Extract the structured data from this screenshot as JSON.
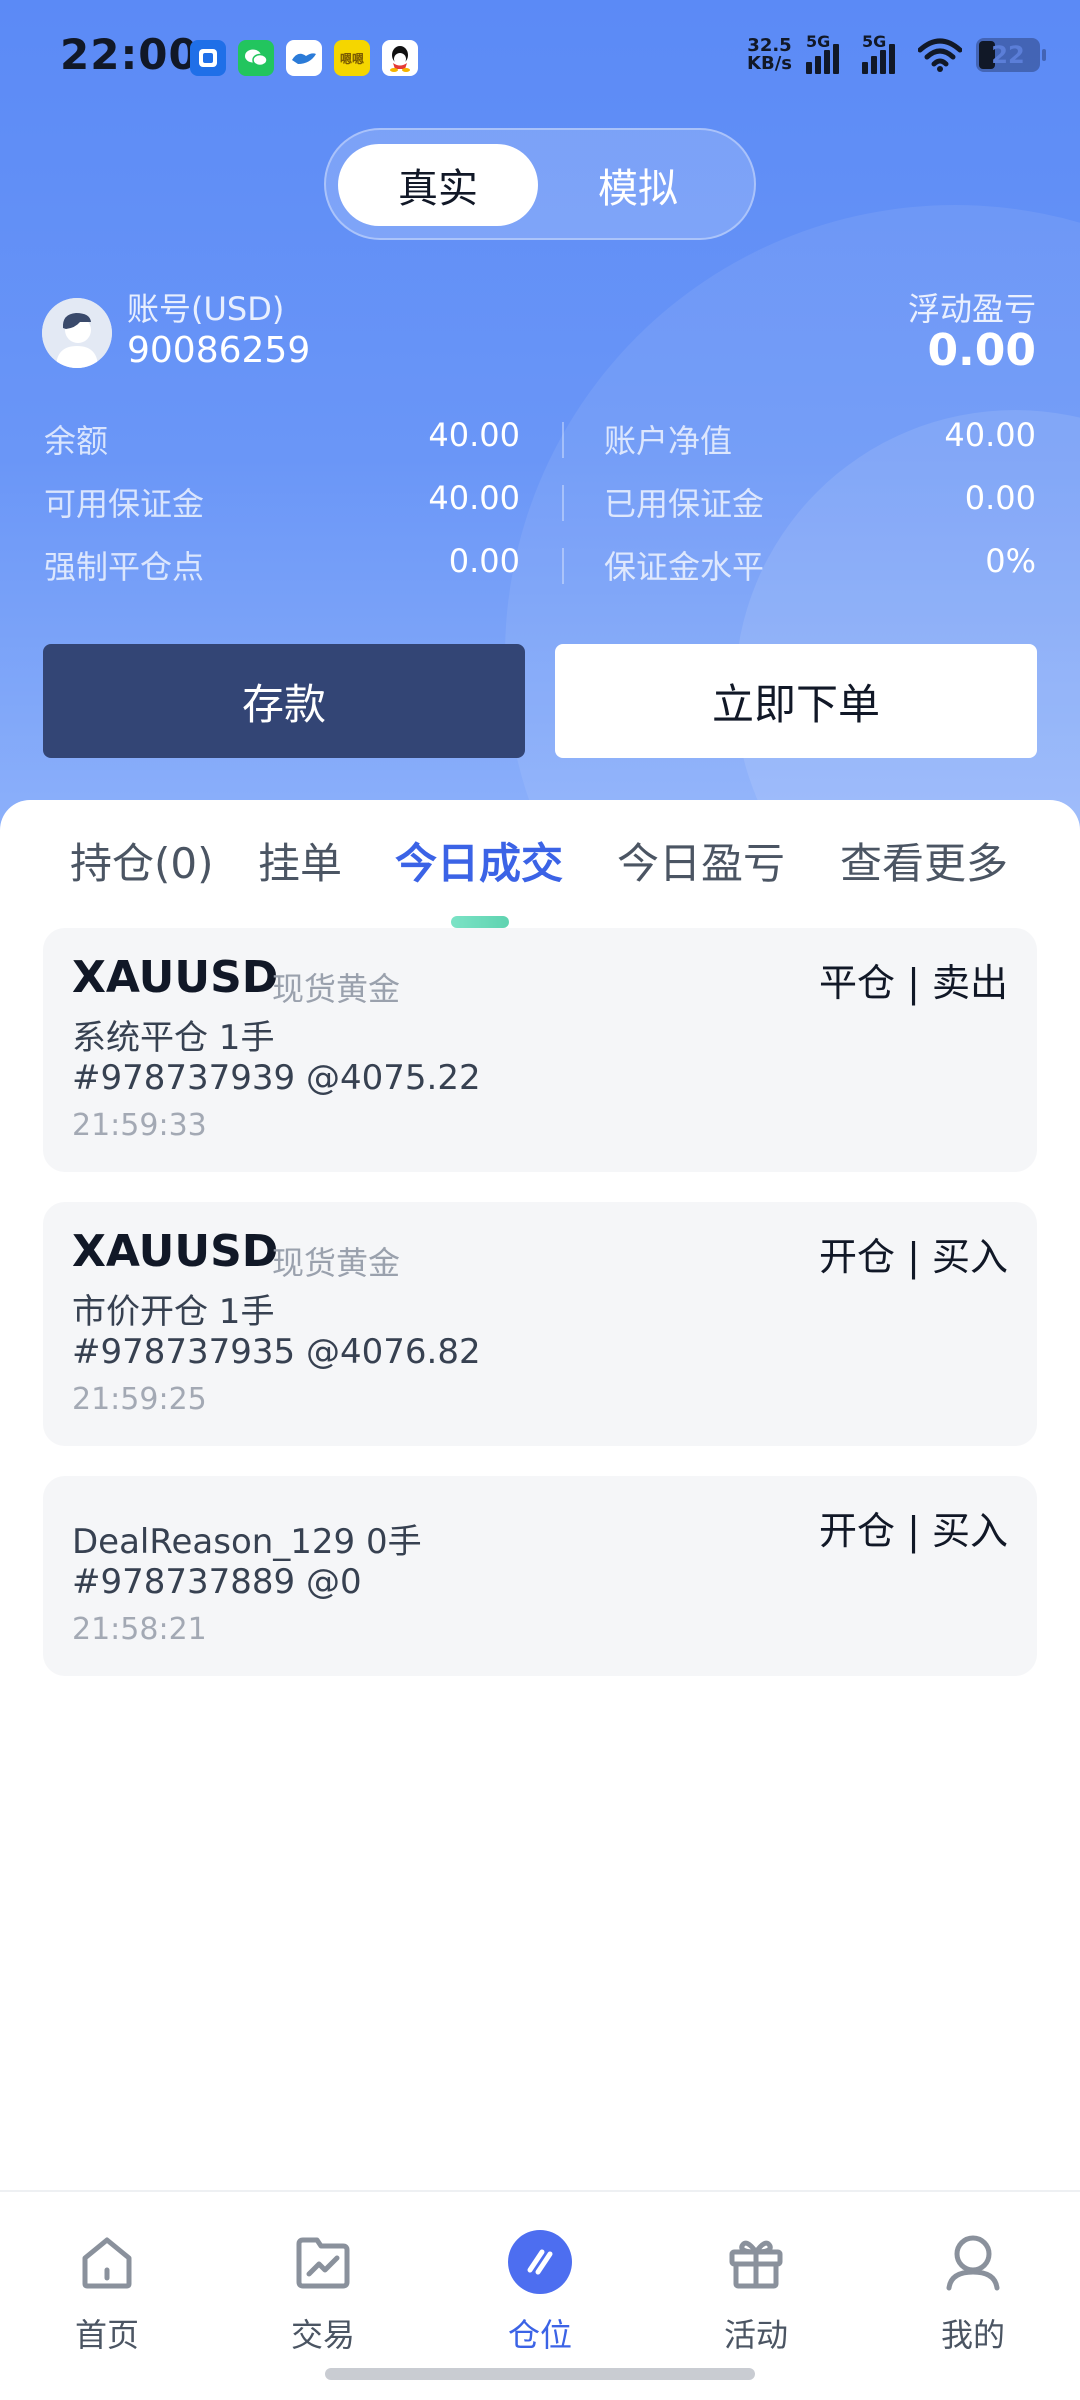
{
  "status_bar": {
    "time": "22:00",
    "net_speed_value": "32.5",
    "net_speed_unit": "KB/s",
    "signal1_label": "5G",
    "signal2_label": "5G",
    "battery": "22",
    "app_icons": [
      "alipay-icon",
      "wechat-icon",
      "bird-app-icon",
      "hh-app-icon",
      "qq-icon"
    ],
    "app_icon_text": {
      "hh": "嗯嗯"
    }
  },
  "mode_switch": {
    "real": "真实",
    "demo": "模拟",
    "selected": "真实"
  },
  "account": {
    "label": "账号(USD)",
    "number": "90086259",
    "floating_pnl_label": "浮动盈亏",
    "floating_pnl_value": "0.00"
  },
  "stats": {
    "balance_label": "余额",
    "balance_value": "40.00",
    "equity_label": "账户净值",
    "equity_value": "40.00",
    "free_margin_label": "可用保证金",
    "free_margin_value": "40.00",
    "used_margin_label": "已用保证金",
    "used_margin_value": "0.00",
    "stop_out_label": "强制平仓点",
    "stop_out_value": "0.00",
    "margin_level_label": "保证金水平",
    "margin_level_value": "0%"
  },
  "actions": {
    "deposit": "存款",
    "place_order": "立即下单"
  },
  "tabs": {
    "positions": "持仓(0)",
    "pending": "挂单",
    "today_deals": "今日成交",
    "today_pnl": "今日盈亏",
    "more": "查看更多",
    "active": "今日成交"
  },
  "deals": [
    {
      "symbol": "XAUUSD",
      "symbol_name": "现货黄金",
      "action": "平仓 | 卖出",
      "reason": "系统平仓 1手",
      "ticket": "#978737939 @4075.22",
      "time": "21:59:33"
    },
    {
      "symbol": "XAUUSD",
      "symbol_name": "现货黄金",
      "action": "开仓 | 买入",
      "reason": "市价开仓 1手",
      "ticket": "#978737935 @4076.82",
      "time": "21:59:25"
    },
    {
      "action": "开仓 | 买入",
      "reason": "DealReason_129 0手",
      "ticket": "#978737889 @0",
      "time": "21:58:21"
    }
  ],
  "bottom_nav": {
    "home": "首页",
    "trade": "交易",
    "positions": "仓位",
    "activity": "活动",
    "mine": "我的",
    "active": "仓位"
  },
  "colors": {
    "header_blue": "#5b8af6",
    "accent": "#3b63e6",
    "deposit_button": "#334575",
    "tab_indicator": "#6edcbc"
  }
}
